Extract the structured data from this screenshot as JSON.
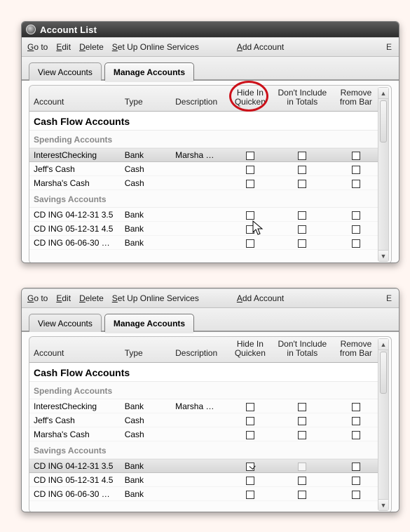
{
  "window_title": "Account List",
  "menus": {
    "goto": "Go to",
    "edit": "Edit",
    "delete": "Delete",
    "online": "Set Up Online Services",
    "add": "Add Account",
    "right_cut": "E"
  },
  "tabs": {
    "view": "View Accounts",
    "manage": "Manage Accounts"
  },
  "cols": {
    "account": "Account",
    "type": "Type",
    "description": "Description",
    "hide1": "Hide In",
    "hide2": "Quicken",
    "dont1": "Don't Include",
    "dont2": "in Totals",
    "remove1": "Remove",
    "remove2": "from Bar"
  },
  "sections": {
    "cashflow": "Cash Flow Accounts",
    "spending": "Spending Accounts",
    "savings": "Savings Accounts"
  },
  "top_rows": [
    {
      "account": "InterestChecking",
      "type": "Bank",
      "desc": "Marsha …",
      "hide": false,
      "dont": false,
      "remove": false,
      "sel": true
    },
    {
      "account": "Jeff's Cash",
      "type": "Cash",
      "desc": "",
      "hide": false,
      "dont": false,
      "remove": false,
      "sel": false
    },
    {
      "account": "Marsha's Cash",
      "type": "Cash",
      "desc": "",
      "hide": false,
      "dont": false,
      "remove": false,
      "sel": false
    }
  ],
  "top_savings": [
    {
      "account": "CD ING 04-12-31 3.5",
      "type": "Bank",
      "desc": "",
      "hide": false,
      "dont": false,
      "remove": false,
      "cursor": true
    },
    {
      "account": "CD ING 05-12-31 4.5",
      "type": "Bank",
      "desc": "",
      "hide": false,
      "dont": false,
      "remove": false
    },
    {
      "account": "CD ING 06-06-30 …",
      "type": "Bank",
      "desc": "",
      "hide": false,
      "dont": false,
      "remove": false
    }
  ],
  "bottom_rows": [
    {
      "account": "InterestChecking",
      "type": "Bank",
      "desc": "Marsha …",
      "hide": false,
      "dont": false,
      "remove": false,
      "sel": false
    },
    {
      "account": "Jeff's Cash",
      "type": "Cash",
      "desc": "",
      "hide": false,
      "dont": false,
      "remove": false,
      "sel": false
    },
    {
      "account": "Marsha's Cash",
      "type": "Cash",
      "desc": "",
      "hide": false,
      "dont": false,
      "remove": false,
      "sel": false
    }
  ],
  "bottom_savings": [
    {
      "account": "CD ING 04-12-31 3.5",
      "type": "Bank",
      "desc": "",
      "hide": true,
      "dont_dim": true,
      "remove": false,
      "sel": true
    },
    {
      "account": "CD ING 05-12-31 4.5",
      "type": "Bank",
      "desc": "",
      "hide": false,
      "dont": false,
      "remove": false
    },
    {
      "account": "CD ING 06-06-30 …",
      "type": "Bank",
      "desc": "",
      "hide": false,
      "dont": false,
      "remove": false
    }
  ]
}
